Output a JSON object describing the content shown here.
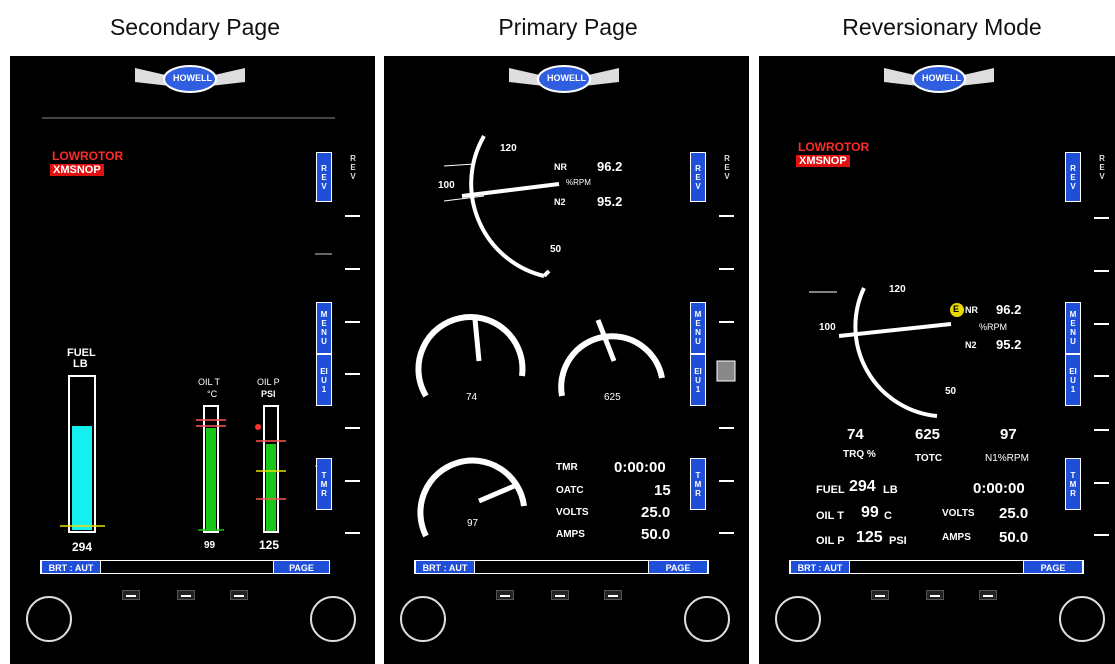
{
  "titles": {
    "left": "Secondary Page",
    "center": "Primary Page",
    "right": "Reversionary Mode"
  },
  "logo": "HOWELL",
  "side_buttons": {
    "rev": "REV",
    "menu": "MENU",
    "eiu": "EIU1",
    "tmr": "TMR",
    "rev_ext": "REV"
  },
  "softkeys": {
    "brt": "BRT : AUT",
    "page": "PAGE"
  },
  "alerts": {
    "lowrotor": "LOWROTOR",
    "xmsnop": "XMSNOP"
  },
  "secondary": {
    "fuel_label": "FUEL",
    "fuel_unit": "LB",
    "fuel_value": "294",
    "oilt_label": "OIL T",
    "oilt_unit": "°C",
    "oilt_value": "99",
    "oilp_label": "OIL P",
    "oilp_unit": "PSI",
    "oilp_value": "125"
  },
  "primary": {
    "rpm_120": "120",
    "rpm_100": "100",
    "rpm_50": "50",
    "nr_label": "NR",
    "nr_value": "96.2",
    "rpm_unit": "%RPM",
    "n2_label": "N2",
    "n2_value": "95.2",
    "trq_value": "74",
    "totc_value": "625",
    "n1_value": "97",
    "tmr_label": "TMR",
    "tmr_value": "0:00:00",
    "oatc_label": "OATC",
    "oatc_value": "15",
    "volts_label": "VOLTS",
    "volts_value": "25.0",
    "amps_label": "AMPS",
    "amps_value": "50.0"
  },
  "reversionary": {
    "trq_value": "74",
    "trq_label": "TRQ %",
    "totc_value": "625",
    "totc_label": "TOTC",
    "n1_value": "97",
    "n1_label": "N1%RPM",
    "fuel_label": "FUEL",
    "fuel_value": "294",
    "fuel_unit": "LB",
    "oilt_label": "OIL T",
    "oilt_value": "99",
    "oilt_unit": "C",
    "oilp_label": "OIL P",
    "oilp_value": "125",
    "oilp_unit": "PSI",
    "tmr_value": "0:00:00",
    "volts_label": "VOLTS",
    "volts_value": "25.0",
    "amps_label": "AMPS",
    "amps_value": "50.0",
    "e_badge": "E"
  },
  "colors": {
    "accent_blue": "#1f4fd8",
    "fuel_cyan": "#14f0f0",
    "oil_green": "#18c818",
    "alert_red": "#e01010"
  }
}
